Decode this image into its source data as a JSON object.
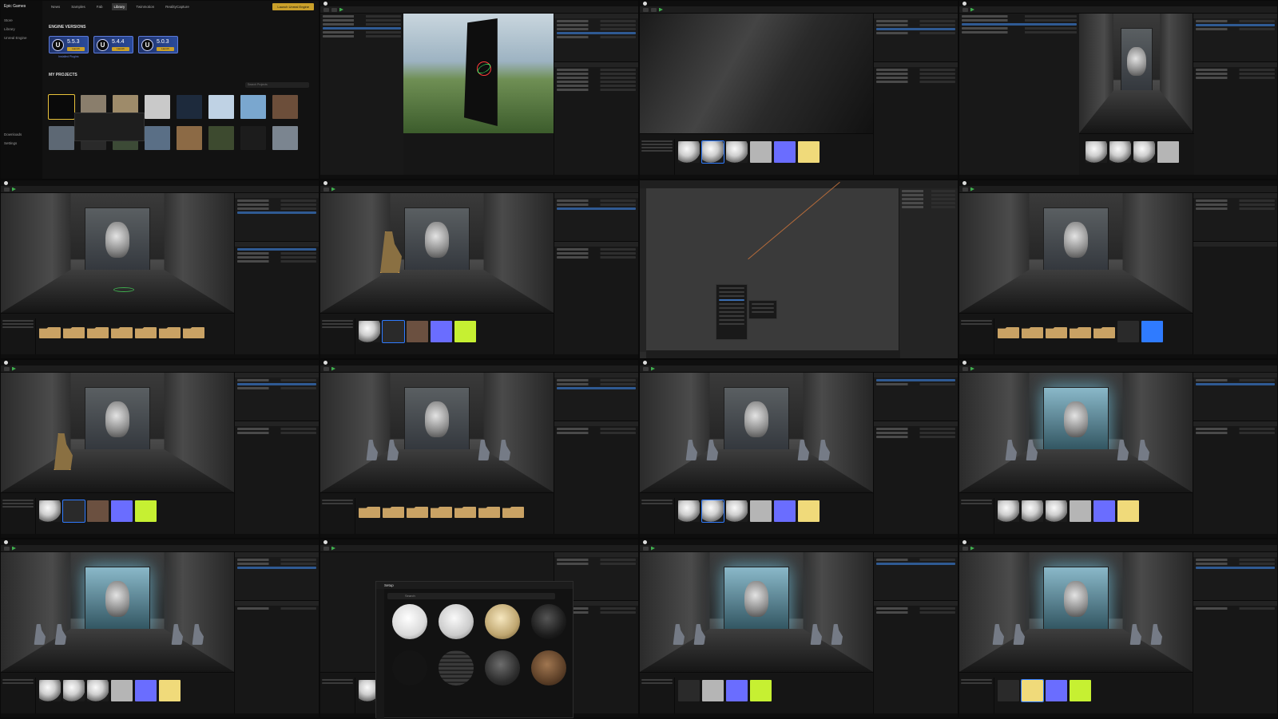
{
  "launcher": {
    "brand": "Epic Games",
    "nav": [
      "Store",
      "Library",
      "Unreal Engine",
      "Downloads",
      "Settings"
    ],
    "top_tabs": [
      "News",
      "Samples",
      "Fab",
      "Library",
      "Twinmotion",
      "RealityCapture"
    ],
    "active_tab": "Library",
    "launch_button": "Launch Unreal Engine",
    "engine_versions_title": "ENGINE VERSIONS",
    "engines": [
      {
        "version": "5.5.3",
        "button": "Launch"
      },
      {
        "version": "5.4.4",
        "button": "Launch"
      },
      {
        "version": "5.0.3",
        "button": "Launch"
      }
    ],
    "engine_links": "Installed Plugins",
    "projects_title": "MY PROJECTS",
    "search_placeholder": "Search Projects"
  },
  "picker": {
    "title": "Setup",
    "search_placeholder": "Search"
  },
  "colors": {
    "accent_blue": "#2f7bff",
    "launch_gold": "#caa02a",
    "play_green": "#3fae4e"
  }
}
